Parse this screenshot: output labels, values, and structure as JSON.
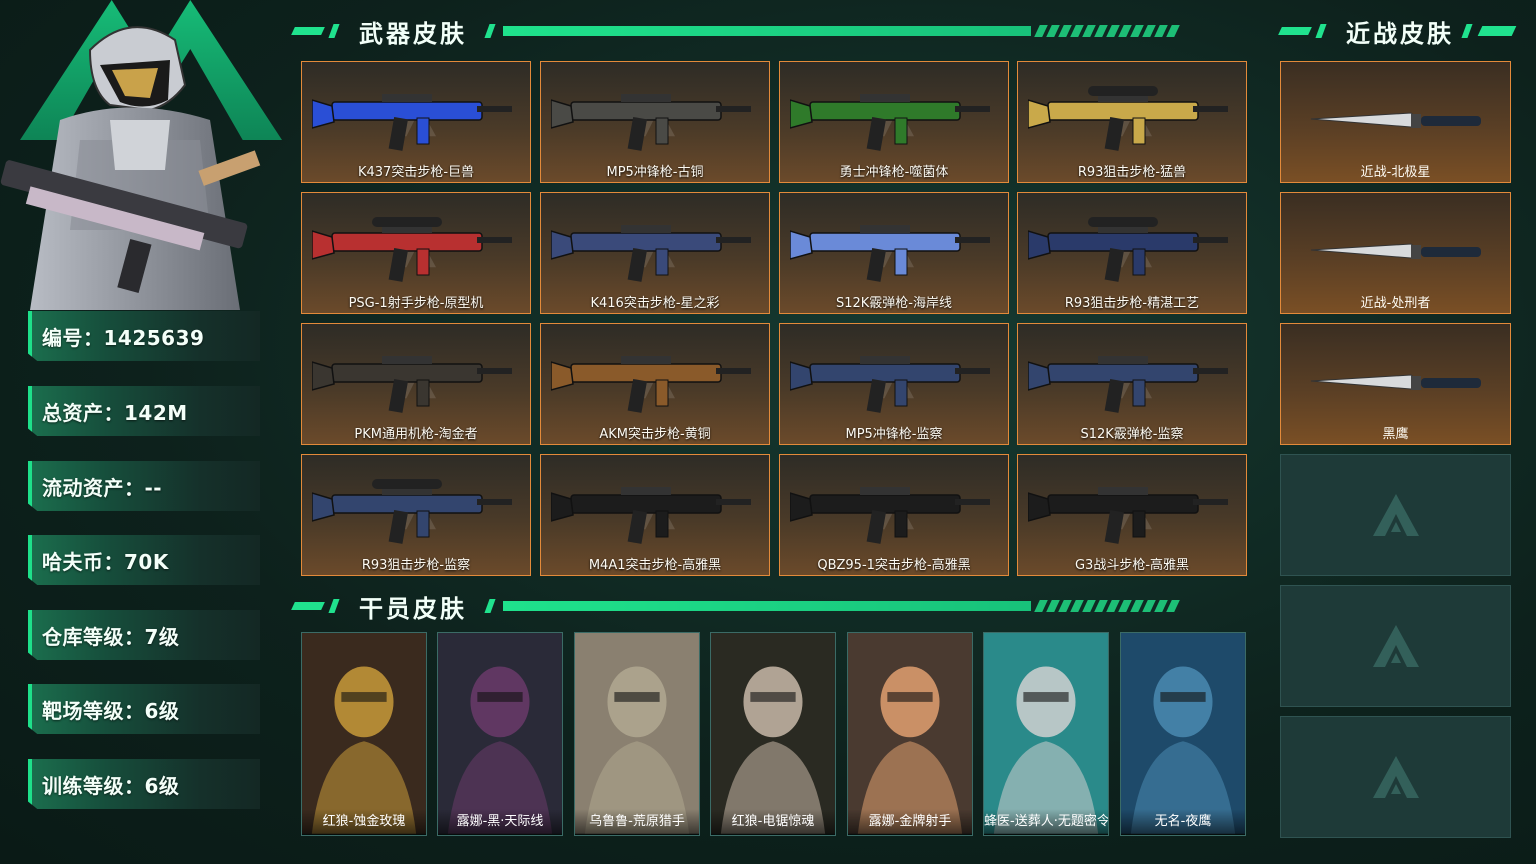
{
  "stats": [
    {
      "label": "编号：1425639"
    },
    {
      "label": "总资产：142M"
    },
    {
      "label": "流动资产：--"
    },
    {
      "label": "哈夫币：70K"
    },
    {
      "label": "仓库等级：7级"
    },
    {
      "label": "靶场等级：6级"
    },
    {
      "label": "训练等级：6级"
    }
  ],
  "sections": {
    "weapons": "武器皮肤",
    "melee": "近战皮肤",
    "operators": "干员皮肤"
  },
  "weapons": [
    {
      "name": "K437突击步枪-巨兽",
      "color": "#2a4fd6",
      "icon": "assault-rifle-icon"
    },
    {
      "name": "MP5冲锋枪-古铜",
      "color": "#4a4a46",
      "icon": "smg-icon"
    },
    {
      "name": "勇士冲锋枪-噬菌体",
      "color": "#2f7a2a",
      "icon": "smg-icon"
    },
    {
      "name": "R93狙击步枪-猛兽",
      "color": "#c9a94a",
      "icon": "sniper-rifle-icon"
    },
    {
      "name": "PSG-1射手步枪-原型机",
      "color": "#b83030",
      "icon": "marksman-rifle-icon"
    },
    {
      "name": "K416突击步枪-星之彩",
      "color": "#3a4a7a",
      "icon": "assault-rifle-icon"
    },
    {
      "name": "S12K霰弹枪-海岸线",
      "color": "#6a8ad8",
      "icon": "shotgun-icon"
    },
    {
      "name": "R93狙击步枪-精湛工艺",
      "color": "#2a3a6a",
      "icon": "sniper-rifle-icon"
    },
    {
      "name": "PKM通用机枪-淘金者",
      "color": "#3a3630",
      "icon": "machine-gun-icon"
    },
    {
      "name": "AKM突击步枪-黄铜",
      "color": "#8a5a2a",
      "icon": "assault-rifle-icon"
    },
    {
      "name": "MP5冲锋枪-监察",
      "color": "#33456e",
      "icon": "smg-icon"
    },
    {
      "name": "S12K霰弹枪-监察",
      "color": "#33456e",
      "icon": "shotgun-icon"
    },
    {
      "name": "R93狙击步枪-监察",
      "color": "#33456e",
      "icon": "sniper-rifle-icon"
    },
    {
      "name": "M4A1突击步枪-高雅黑",
      "color": "#1c1c1c",
      "icon": "assault-rifle-icon"
    },
    {
      "name": "QBZ95-1突击步枪-高雅黑",
      "color": "#1c1c1c",
      "icon": "bullpup-rifle-icon"
    },
    {
      "name": "G3战斗步枪-高雅黑",
      "color": "#1c1c1c",
      "icon": "battle-rifle-icon"
    }
  ],
  "melee": [
    {
      "name": "近战-北极星",
      "icon": "knife-icon"
    },
    {
      "name": "近战-处刑者",
      "icon": "knife-icon"
    },
    {
      "name": "黑鹰",
      "icon": "knife-icon"
    }
  ],
  "operators": [
    {
      "name": "红狼-蚀金玫瑰",
      "bg": "#3a2a1e",
      "accent": "#c89a3a"
    },
    {
      "name": "露娜-黑·天际线",
      "bg": "#2a2a38",
      "accent": "#6a3a6a"
    },
    {
      "name": "乌鲁鲁-荒原猎手",
      "bg": "#8a8070",
      "accent": "#b0a890"
    },
    {
      "name": "红狼-电锯惊魂",
      "bg": "#2a2a22",
      "accent": "#c8b8a8"
    },
    {
      "name": "露娜-金牌射手",
      "bg": "#4a3a30",
      "accent": "#e0a070"
    },
    {
      "name": "蜂医-送葬人·无题密令",
      "bg": "#2a8a8a",
      "accent": "#d0d0d0"
    },
    {
      "name": "无名-夜鹰",
      "bg": "#1e4a6a",
      "accent": "#4a8ab0"
    }
  ]
}
